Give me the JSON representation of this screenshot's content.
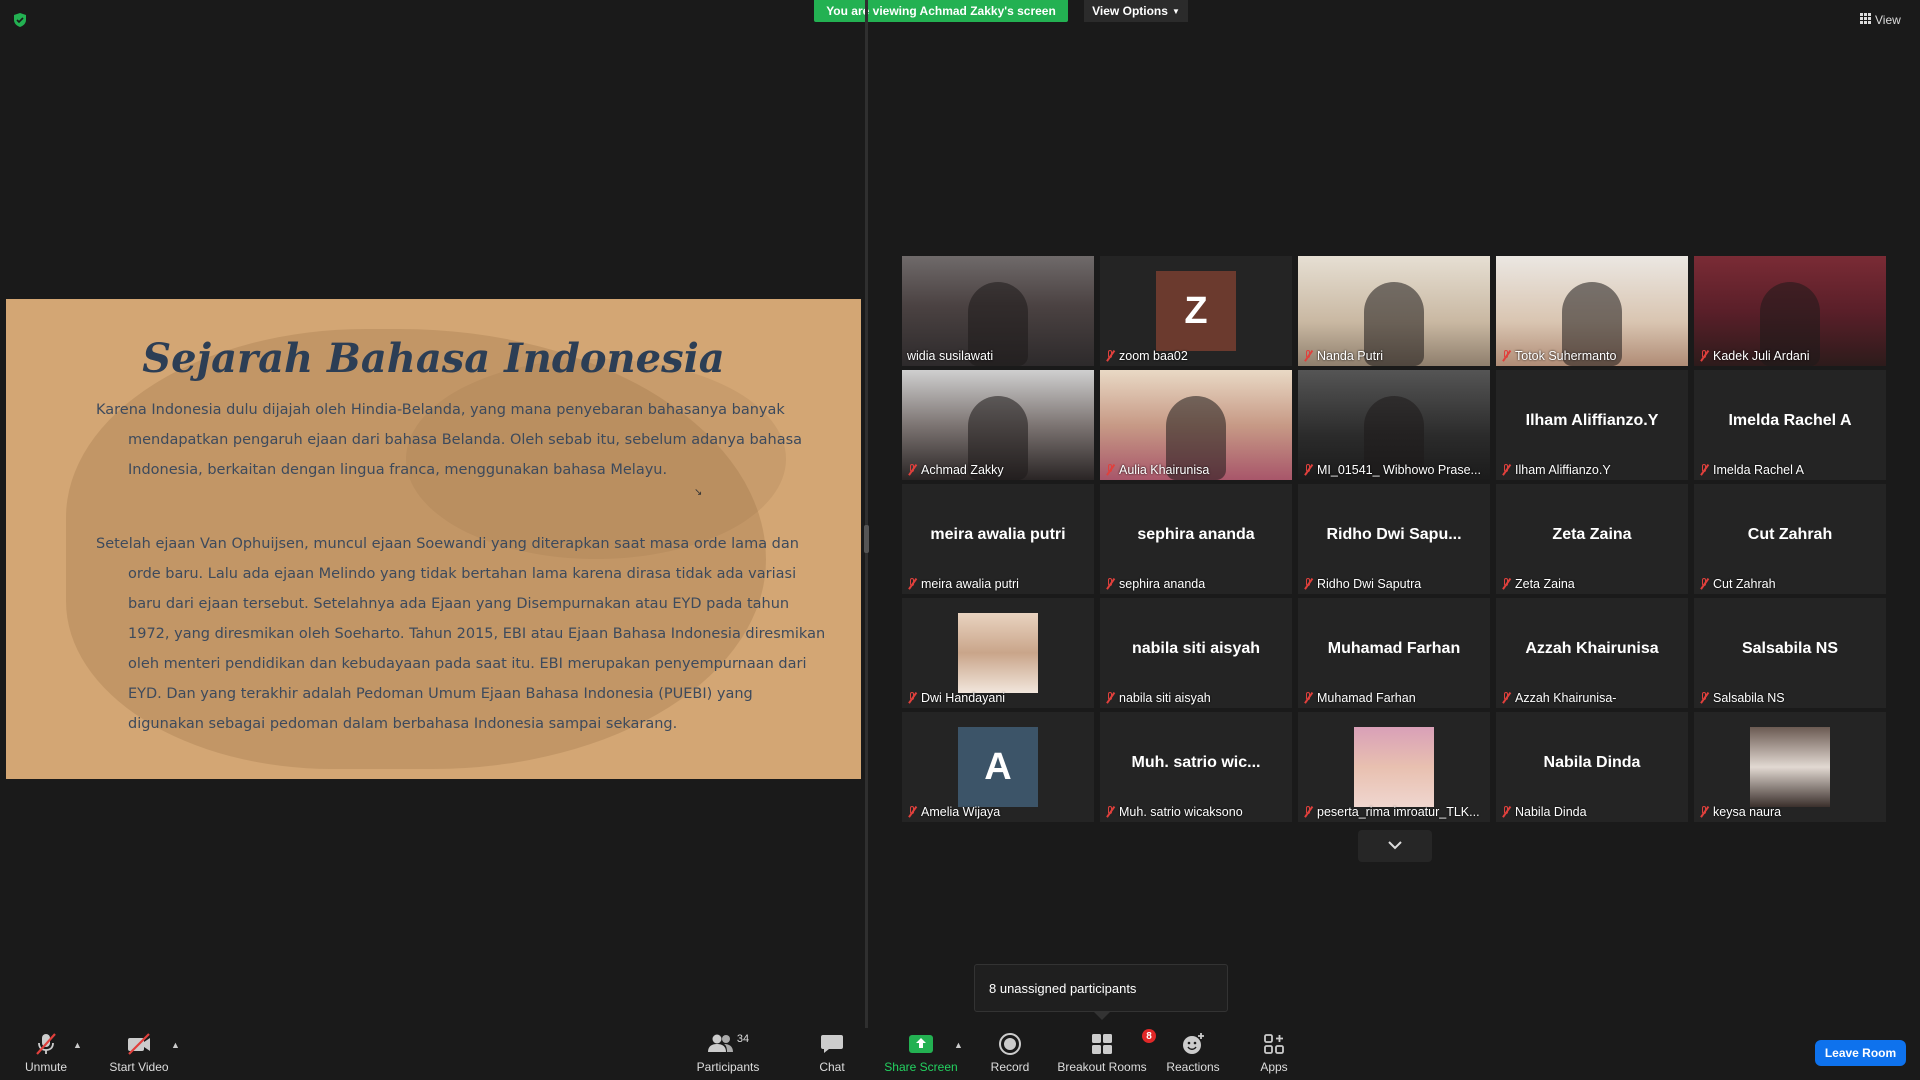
{
  "banner": {
    "viewing_text": "You are viewing Achmad Zakky's screen",
    "view_options_label": "View Options",
    "view_label": "View"
  },
  "slide": {
    "title": "Sejarah Bahasa Indonesia",
    "paragraph1": "Karena Indonesia dulu dijajah oleh Hindia-Belanda, yang mana penyebaran bahasanya banyak mendapatkan pengaruh ejaan dari bahasa Belanda. Oleh sebab itu, sebelum adanya bahasa Indonesia, berkaitan dengan lingua franca, menggunakan bahasa Melayu.",
    "paragraph2": "Setelah ejaan Van Ophuijsen, muncul ejaan Soewandi yang diterapkan saat masa orde lama dan orde baru. Lalu ada ejaan Melindo yang tidak bertahan lama karena dirasa tidak ada variasi baru dari ejaan tersebut. Setelahnya ada Ejaan yang Disempurnakan atau EYD pada tahun 1972, yang diresmikan oleh Soeharto. Tahun 2015, EBI atau Ejaan Bahasa Indonesia diresmikan oleh menteri pendidikan dan kebudayaan pada saat itu. EBI merupakan penyempurnaan dari EYD. Dan yang terakhir adalah Pedoman Umum Ejaan Bahasa Indonesia (PUEBI) yang digunakan sebagai pedoman dalam berbahasa Indonesia sampai sekarang."
  },
  "gallery": {
    "tiles": [
      {
        "name": "widia susilawati",
        "big": "",
        "kind": "video",
        "active": true
      },
      {
        "name": "zoom baa02",
        "big": "",
        "kind": "avatar",
        "letter": "Z",
        "avatar_color": "#6b3a2e"
      },
      {
        "name": "Nanda Putri",
        "big": "",
        "kind": "video"
      },
      {
        "name": "Totok Suhermanto",
        "big": "",
        "kind": "video"
      },
      {
        "name": "Kadek Juli Ardani",
        "big": "",
        "kind": "video"
      },
      {
        "name": "Achmad Zakky",
        "big": "",
        "kind": "video"
      },
      {
        "name": "Aulia Khairunisa",
        "big": "",
        "kind": "video"
      },
      {
        "name": "MI_01541_ Wibhowo Prase...",
        "big": "",
        "kind": "video"
      },
      {
        "name": "Ilham Aliffianzo.Y",
        "big": "Ilham Aliffianzo.Y",
        "kind": "name"
      },
      {
        "name": "Imelda Rachel A",
        "big": "Imelda Rachel A",
        "kind": "name"
      },
      {
        "name": "meira awalia putri",
        "big": "meira awalia putri",
        "kind": "name"
      },
      {
        "name": "sephira ananda",
        "big": "sephira ananda",
        "kind": "name"
      },
      {
        "name": "Ridho Dwi Saputra",
        "big": "Ridho  Dwi  Sapu...",
        "kind": "name"
      },
      {
        "name": "Zeta Zaina",
        "big": "Zeta Zaina",
        "kind": "name"
      },
      {
        "name": "Cut Zahrah",
        "big": "Cut Zahrah",
        "kind": "name"
      },
      {
        "name": "Dwi Handayani",
        "big": "",
        "kind": "pic"
      },
      {
        "name": "nabila siti aisyah",
        "big": "nabila siti aisyah",
        "kind": "name"
      },
      {
        "name": "Muhamad Farhan",
        "big": "Muhamad Farhan",
        "kind": "name"
      },
      {
        "name": "Azzah Khairunisa-",
        "big": "Azzah Khairunisa",
        "kind": "name"
      },
      {
        "name": "Salsabila NS",
        "big": "Salsabila NS",
        "kind": "name"
      },
      {
        "name": "Amelia Wijaya",
        "big": "",
        "kind": "avatar",
        "letter": "A",
        "avatar_color": "#3c5468"
      },
      {
        "name": "Muh. satrio wicaksono",
        "big": "Muh.  satrio  wic...",
        "kind": "name"
      },
      {
        "name": "peserta_rima imroatur_TLK...",
        "big": "",
        "kind": "pic"
      },
      {
        "name": "Nabila Dinda",
        "big": "Nabila Dinda",
        "kind": "name"
      },
      {
        "name": "keysa naura",
        "big": "",
        "kind": "pic"
      }
    ]
  },
  "popup": {
    "unassigned": "8 unassigned participants"
  },
  "toolbar": {
    "unmute": "Unmute",
    "start_video": "Start Video",
    "participants": "Participants",
    "participants_count": "34",
    "chat": "Chat",
    "share_screen": "Share Screen",
    "record": "Record",
    "breakout_rooms": "Breakout Rooms",
    "breakout_badge": "8",
    "reactions": "Reactions",
    "apps": "Apps",
    "leave_room": "Leave Room"
  },
  "colors": {
    "accent_green": "#23b152",
    "active_speaker": "#e5e043",
    "leave_blue": "#0e72ed",
    "slide_bg": "#d3a674"
  }
}
